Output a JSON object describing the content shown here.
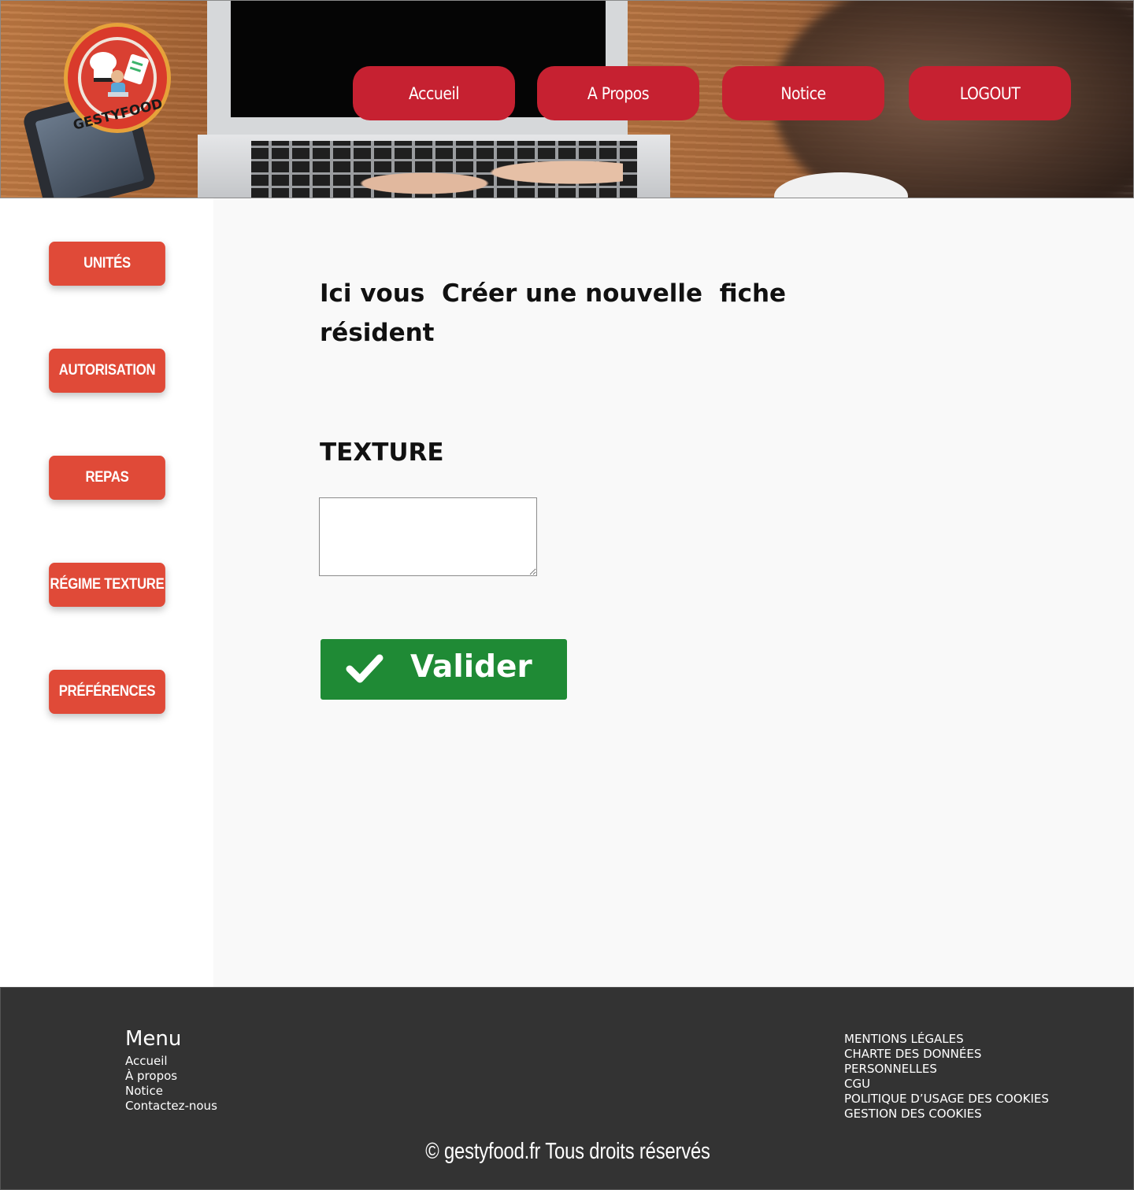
{
  "header": {
    "logo_text": "GESTYFOOD",
    "nav": [
      {
        "label": "Accueil"
      },
      {
        "label": "A Propos"
      },
      {
        "label": "Notice"
      },
      {
        "label": "LOGOUT"
      }
    ],
    "nav_color": "#c62131"
  },
  "sidebar": {
    "items": [
      {
        "label": "UNITÉS"
      },
      {
        "label": "AUTORISATION"
      },
      {
        "label": "REPAS"
      },
      {
        "label": "RÉGIME TEXTURE"
      },
      {
        "label": "PRÉFÉRENCES"
      }
    ],
    "button_color": "#e04a38"
  },
  "main": {
    "title": "Ici vous  Créer une nouvelle  fiche\nrésident",
    "field_label": "TEXTURE",
    "texture_value": "",
    "submit_label": "Valider",
    "submit_icon": "check-icon",
    "submit_color": "#1f8a35"
  },
  "footer": {
    "menu_title": "Menu",
    "menu_links": [
      "Accueil",
      "À propos",
      "Notice",
      "Contactez-nous"
    ],
    "legal_links": [
      "MENTIONS LÉGALES",
      "CHARTE DES DONNÉES",
      "PERSONNELLES",
      "CGU",
      "POLITIQUE D’USAGE DES COOKIES",
      "GESTION DES COOKIES"
    ],
    "copyright": "© gestyfood.fr  Tous droits réservés",
    "background": "#333333"
  }
}
